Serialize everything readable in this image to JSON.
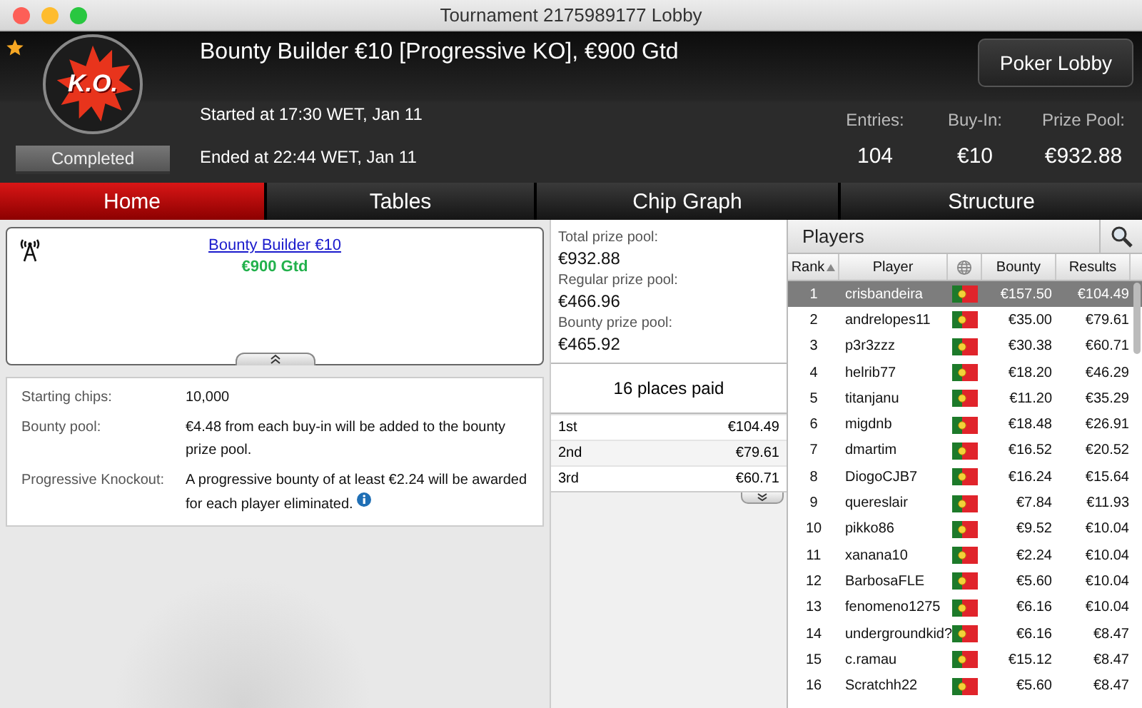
{
  "window": {
    "title": "Tournament 2175989177 Lobby"
  },
  "header": {
    "favorite": true,
    "logo_text": "K.O.",
    "status": "Completed",
    "title": "Bounty Builder €10 [Progressive KO], €900 Gtd",
    "started": "Started at 17:30 WET, Jan 11",
    "ended": "Ended at 22:44 WET, Jan 11",
    "button": "Poker Lobby",
    "stats": [
      {
        "label": "Entries:",
        "value": "104"
      },
      {
        "label": "Buy-In:",
        "value": "€10"
      },
      {
        "label": "Prize Pool:",
        "value": "€932.88"
      }
    ]
  },
  "tabs": [
    {
      "label": "Home",
      "selected": true
    },
    {
      "label": "Tables",
      "selected": false
    },
    {
      "label": "Chip Graph",
      "selected": false
    },
    {
      "label": "Structure",
      "selected": false
    }
  ],
  "banner": {
    "link": "Bounty Builder €10",
    "guarantee": "€900 Gtd"
  },
  "details": [
    {
      "label": "Starting chips:",
      "value": "10,000",
      "info": false
    },
    {
      "label": "Bounty pool:",
      "value": "€4.48 from each buy-in will be added to the bounty prize pool.",
      "info": false
    },
    {
      "label": "Progressive Knockout:",
      "value": "A progressive bounty of at least €2.24 will be awarded for each player eliminated.",
      "info": true
    }
  ],
  "prize_pools": [
    {
      "label": "Total prize pool:",
      "value": "€932.88"
    },
    {
      "label": "Regular prize pool:",
      "value": "€466.96"
    },
    {
      "label": "Bounty prize pool:",
      "value": "€465.92"
    }
  ],
  "places_paid": "16 places paid",
  "payouts": [
    {
      "place": "1st",
      "amount": "€104.49"
    },
    {
      "place": "2nd",
      "amount": "€79.61"
    },
    {
      "place": "3rd",
      "amount": "€60.71"
    }
  ],
  "players": {
    "title": "Players",
    "columns": [
      {
        "label": "Rank",
        "sorted": true
      },
      {
        "label": "Player",
        "sorted": false
      },
      {
        "kind": "globe",
        "sorted": false
      },
      {
        "label": "Bounty",
        "sorted": false
      },
      {
        "label": "Results",
        "sorted": false
      }
    ],
    "rows": [
      {
        "rank": "1",
        "player": "crisbandeira",
        "bounty": "€157.50",
        "result": "€104.49",
        "selected": true
      },
      {
        "rank": "2",
        "player": "andrelopes11",
        "bounty": "€35.00",
        "result": "€79.61",
        "selected": false
      },
      {
        "rank": "3",
        "player": "p3r3zzz",
        "bounty": "€30.38",
        "result": "€60.71",
        "selected": false
      },
      {
        "rank": "4",
        "player": "helrib77",
        "bounty": "€18.20",
        "result": "€46.29",
        "selected": false
      },
      {
        "rank": "5",
        "player": "titanjanu",
        "bounty": "€11.20",
        "result": "€35.29",
        "selected": false
      },
      {
        "rank": "6",
        "player": "migdnb",
        "bounty": "€18.48",
        "result": "€26.91",
        "selected": false
      },
      {
        "rank": "7",
        "player": "dmartim",
        "bounty": "€16.52",
        "result": "€20.52",
        "selected": false
      },
      {
        "rank": "8",
        "player": "DiogoCJB7",
        "bounty": "€16.24",
        "result": "€15.64",
        "selected": false
      },
      {
        "rank": "9",
        "player": "quereslair",
        "bounty": "€7.84",
        "result": "€11.93",
        "selected": false
      },
      {
        "rank": "10",
        "player": "pikko86",
        "bounty": "€9.52",
        "result": "€10.04",
        "selected": false
      },
      {
        "rank": "11",
        "player": "xanana10",
        "bounty": "€2.24",
        "result": "€10.04",
        "selected": false
      },
      {
        "rank": "12",
        "player": "BarbosaFLE",
        "bounty": "€5.60",
        "result": "€10.04",
        "selected": false
      },
      {
        "rank": "13",
        "player": "fenomeno1275",
        "bounty": "€6.16",
        "result": "€10.04",
        "selected": false
      },
      {
        "rank": "14",
        "player": "undergroundkid?",
        "bounty": "€6.16",
        "result": "€8.47",
        "selected": false
      },
      {
        "rank": "15",
        "player": "c.ramau",
        "bounty": "€15.12",
        "result": "€8.47",
        "selected": false
      },
      {
        "rank": "16",
        "player": "Scratchh22",
        "bounty": "€5.60",
        "result": "€8.47",
        "selected": false
      }
    ]
  }
}
